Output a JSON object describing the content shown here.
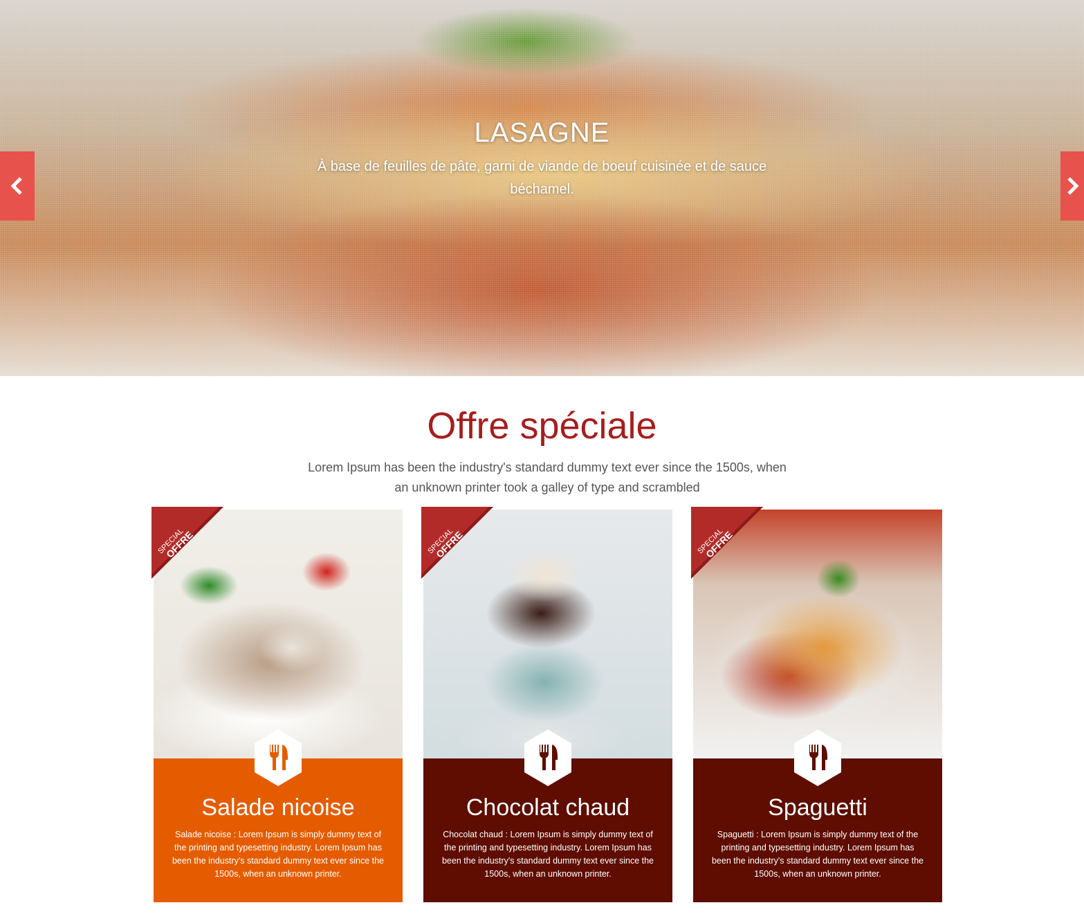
{
  "hero": {
    "title": "LASAGNE",
    "subtitle": "À base de feuilles de pâte, garni de viande de boeuf cuisinée et de sauce béchamel.",
    "prev_icon": "chevron-left-icon",
    "next_icon": "chevron-right-icon"
  },
  "offer": {
    "title": "Offre spéciale",
    "description": "Lorem Ipsum has been the industry's standard dummy text ever since the 1500s, when an unknown printer took a galley of type and scrambled"
  },
  "ribbon": {
    "line1": "SPECIAL",
    "line2": "OFFRE"
  },
  "cards": [
    {
      "name": "Salade nicoise",
      "text": "Salade nicoise : Lorem Ipsum is simply dummy text of the printing and typesetting industry. Lorem Ipsum has been the industry's standard dummy text ever since the 1500s, when an unknown printer.",
      "color": "#e55c00",
      "icon": "fork-knife-icon"
    },
    {
      "name": "Chocolat chaud",
      "text": "Chocolat chaud : Lorem Ipsum is simply dummy text of the printing and typesetting industry. Lorem Ipsum has been the industry's standard dummy text ever since the 1500s, when an unknown printer.",
      "color": "#5e0d00",
      "icon": "fork-knife-icon"
    },
    {
      "name": "Spaguetti",
      "text": "Spaguetti : Lorem Ipsum is simply dummy text of the printing and typesetting industry. Lorem Ipsum has been the industry's standard dummy text ever since the 1500s, when an unknown printer.",
      "color": "#5e0d00",
      "icon": "fork-knife-icon"
    }
  ],
  "colors": {
    "accent": "#e8524d",
    "title_red": "#a71d1d",
    "orange": "#e55c00",
    "maroon": "#5e0d00"
  }
}
